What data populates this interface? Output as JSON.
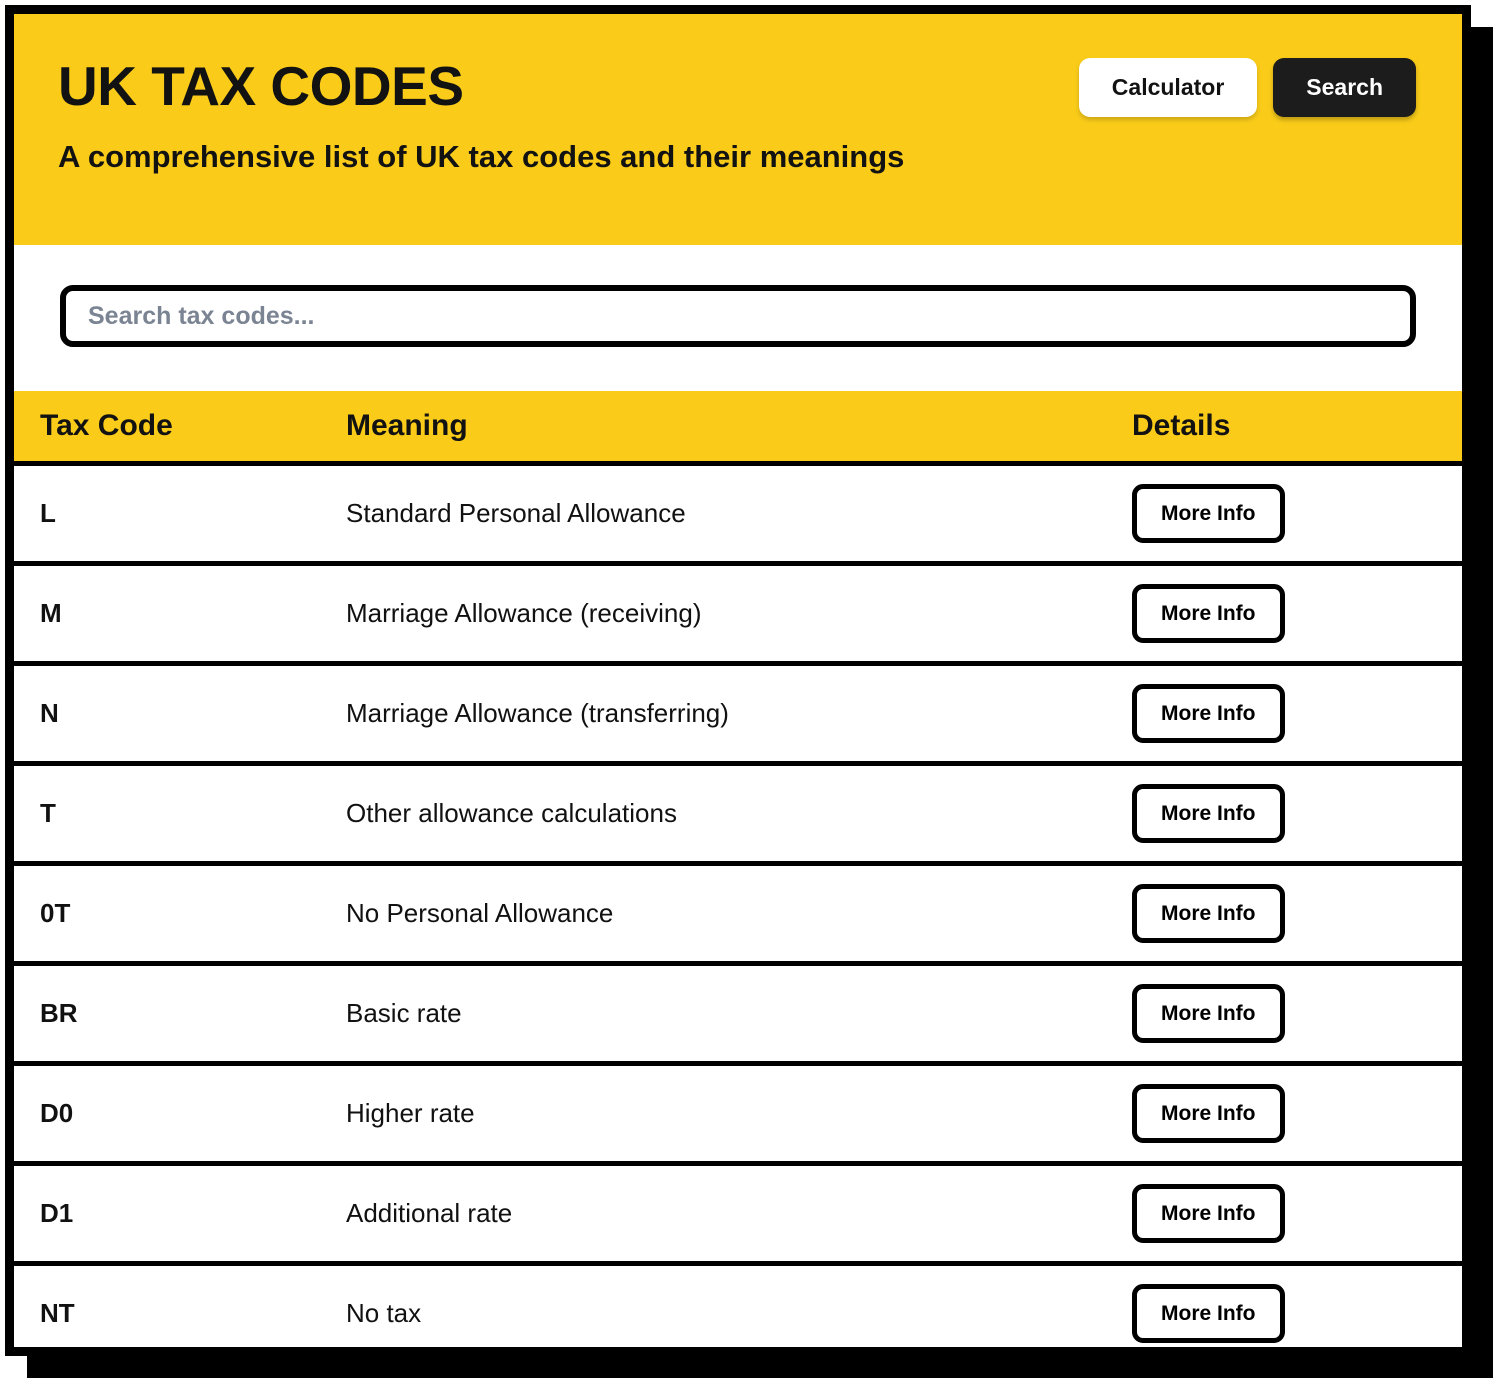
{
  "header": {
    "title": "UK TAX CODES",
    "subtitle": "A comprehensive list of UK tax codes and their meanings",
    "actions": {
      "calculator_label": "Calculator",
      "search_label": "Search"
    }
  },
  "search": {
    "placeholder": "Search tax codes...",
    "value": ""
  },
  "table": {
    "columns": {
      "code": "Tax Code",
      "meaning": "Meaning",
      "details": "Details"
    },
    "more_info_label": "More Info",
    "rows": [
      {
        "code": "L",
        "meaning": "Standard Personal Allowance",
        "action": "More Info"
      },
      {
        "code": "M",
        "meaning": "Marriage Allowance (receiving)",
        "action": "More Info"
      },
      {
        "code": "N",
        "meaning": "Marriage Allowance (transferring)",
        "action": "More Info"
      },
      {
        "code": "T",
        "meaning": "Other allowance calculations",
        "action": "More Info"
      },
      {
        "code": "0T",
        "meaning": "No Personal Allowance",
        "action": "More Info"
      },
      {
        "code": "BR",
        "meaning": "Basic rate",
        "action": "More Info"
      },
      {
        "code": "D0",
        "meaning": "Higher rate",
        "action": "More Info"
      },
      {
        "code": "D1",
        "meaning": "Additional rate",
        "action": "More Info"
      },
      {
        "code": "NT",
        "meaning": "No tax",
        "action": "More Info"
      }
    ]
  },
  "colors": {
    "brand_yellow": "#FACC19",
    "ink_black": "#000000",
    "button_dark": "#1C1C1C",
    "placeholder_gray": "#7B8492",
    "surface_white": "#FFFFFF"
  }
}
